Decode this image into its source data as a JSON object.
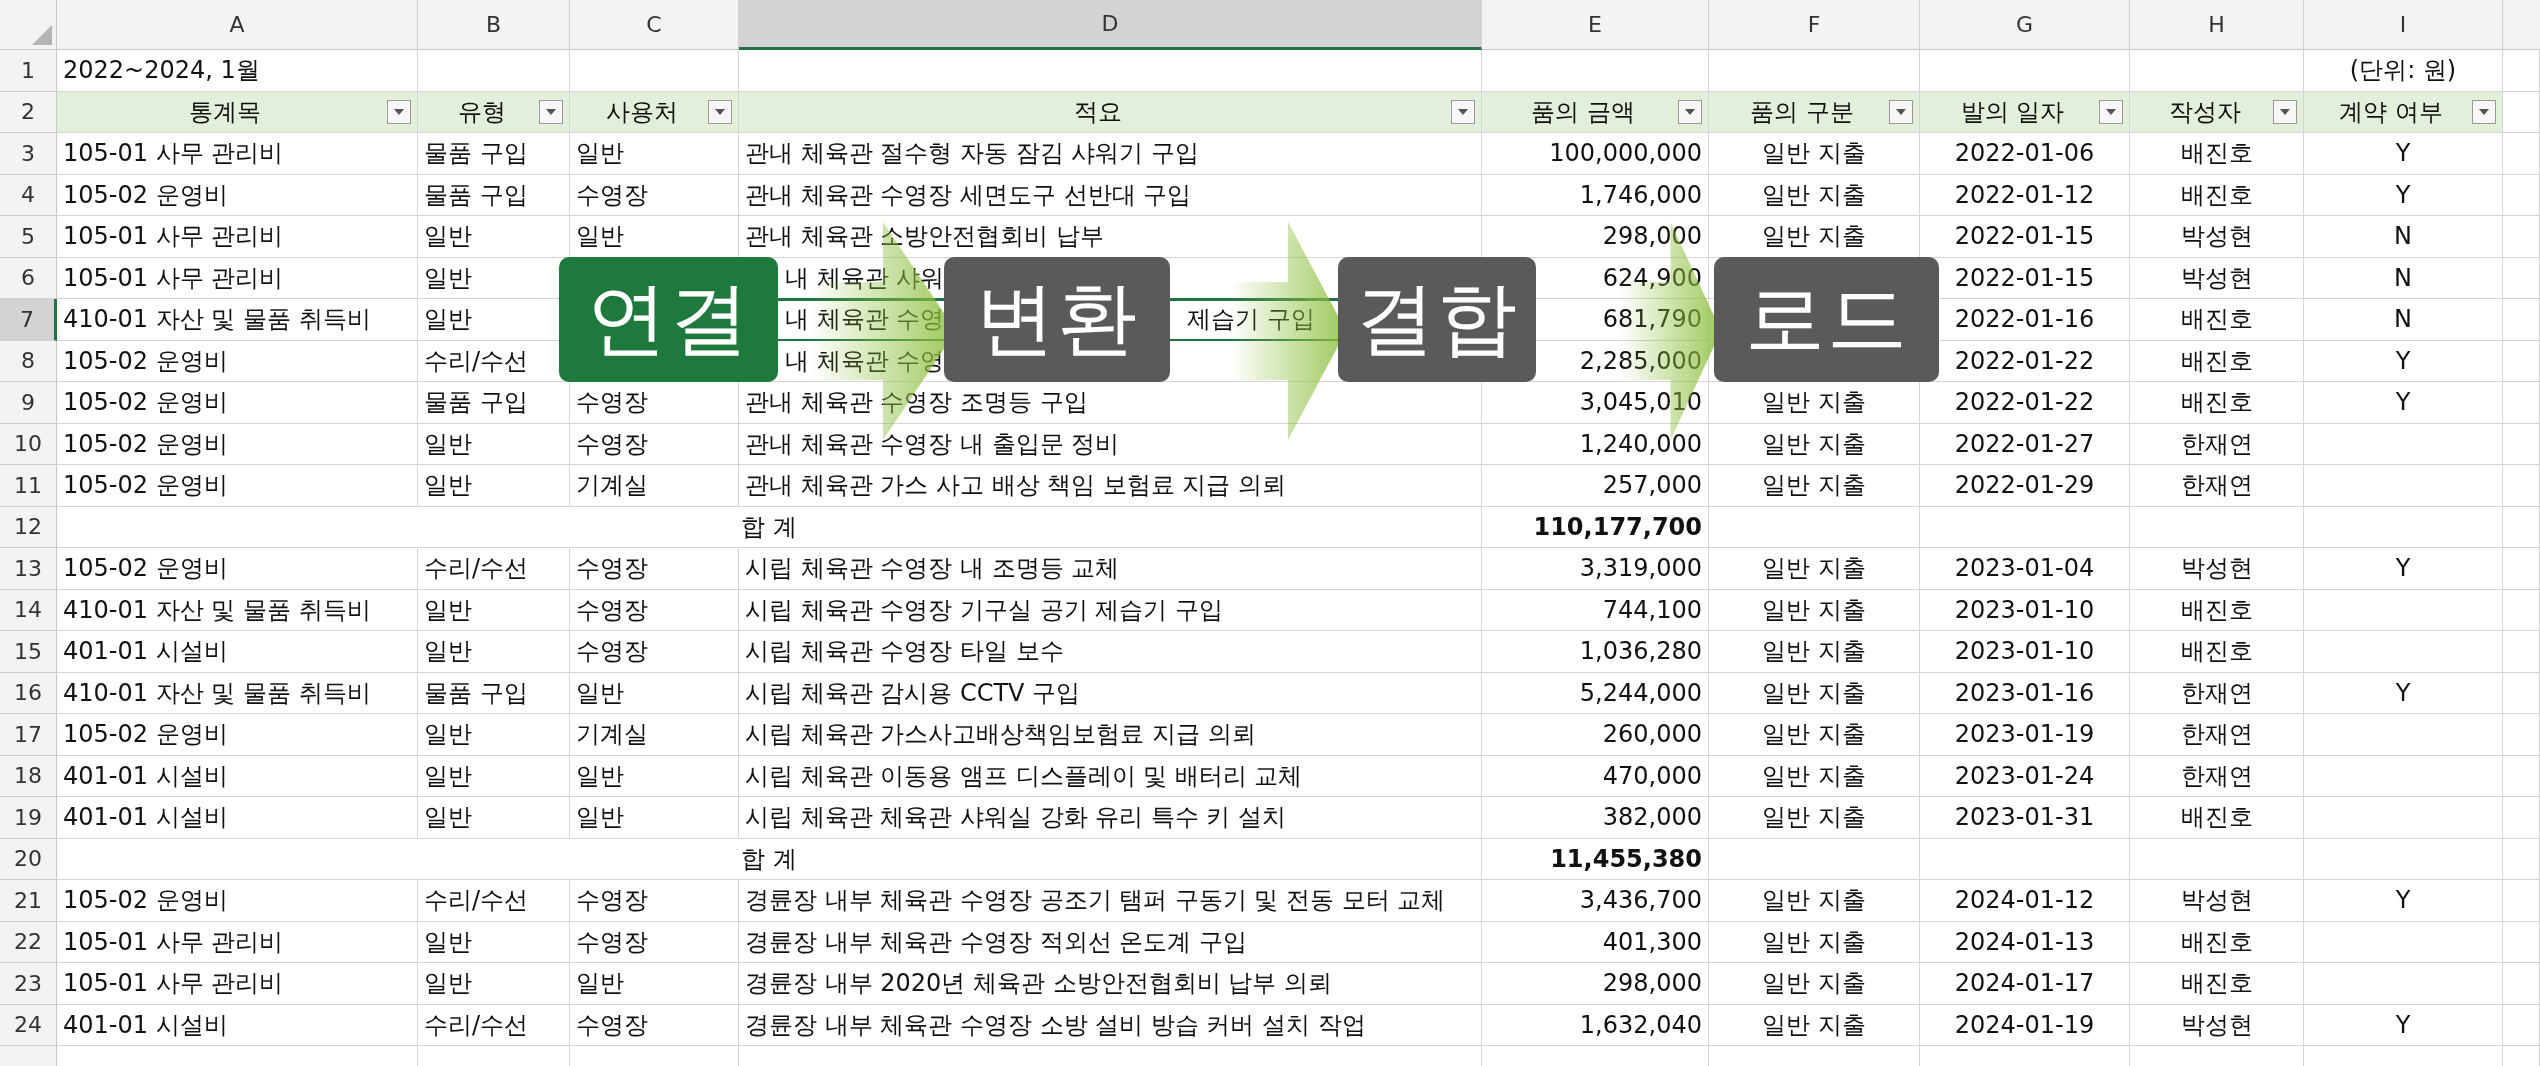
{
  "columns": [
    {
      "letter": "A",
      "selected": false
    },
    {
      "letter": "B",
      "selected": false
    },
    {
      "letter": "C",
      "selected": false
    },
    {
      "letter": "D",
      "selected": true
    },
    {
      "letter": "E",
      "selected": false
    },
    {
      "letter": "F",
      "selected": false
    },
    {
      "letter": "G",
      "selected": false
    },
    {
      "letter": "H",
      "selected": false
    },
    {
      "letter": "I",
      "selected": false
    }
  ],
  "rows": [
    {
      "number": "1",
      "selected": false,
      "kind": "title",
      "title": "2022~2024, 1월",
      "unit": "(단위: 원)"
    },
    {
      "number": "2",
      "selected": false,
      "kind": "header",
      "headers": [
        "통계목",
        "유형",
        "사용처",
        "적요",
        "품의 금액",
        "품의 구분",
        "발의 일자",
        "작성자",
        "계약 여부"
      ]
    },
    {
      "number": "3",
      "selected": false,
      "kind": "data",
      "account": "105-01 사무 관리비",
      "type": "물품 구입",
      "place": "일반",
      "summary": "관내 체육관 절수형 자동 잠김 샤워기 구입",
      "amount": "100,000,000",
      "category": "일반 지출",
      "date": "2022-01-06",
      "author": "배진호",
      "contract": "Y"
    },
    {
      "number": "4",
      "selected": false,
      "kind": "data",
      "account": "105-02 운영비",
      "type": "물품 구입",
      "place": "수영장",
      "summary": "관내 체육관 수영장 세면도구 선반대 구입",
      "amount": "1,746,000",
      "category": "일반 지출",
      "date": "2022-01-12",
      "author": "배진호",
      "contract": "Y"
    },
    {
      "number": "5",
      "selected": false,
      "kind": "data",
      "account": "105-01 사무 관리비",
      "type": "일반",
      "place": "일반",
      "summary": "관내 체육관 소방안전협회비 납부",
      "amount": "298,000",
      "category": "일반 지출",
      "date": "2022-01-15",
      "author": "박성현",
      "contract": "N"
    },
    {
      "number": "6",
      "selected": false,
      "kind": "covered",
      "account": "105-01 사무 관리비",
      "type": "일반",
      "summary": "내 체육관 샤워",
      "amount": "624,900",
      "date": "2022-01-15",
      "author": "박성현",
      "contract": "N"
    },
    {
      "number": "7",
      "selected": true,
      "kind": "covered",
      "account": "410-01 자산 및 물품 취득비",
      "type": "일반",
      "summary": "내 체육관 수영",
      "summary_tail": "제습기 구입",
      "amount": "681,790",
      "date": "2022-01-16",
      "author": "배진호",
      "contract": "N"
    },
    {
      "number": "8",
      "selected": false,
      "kind": "covered",
      "account": "105-02 운영비",
      "type": "수리/수선",
      "summary": "내 체육관 수영",
      "amount": "2,285,000",
      "date": "2022-01-22",
      "author": "배진호",
      "contract": "Y"
    },
    {
      "number": "9",
      "selected": false,
      "kind": "data",
      "account": "105-02 운영비",
      "type": "물품 구입",
      "place": "수영장",
      "summary": "관내 체육관 수영장 조명등 구입",
      "amount": "3,045,010",
      "category": "일반 지출",
      "date": "2022-01-22",
      "author": "배진호",
      "contract": "Y"
    },
    {
      "number": "10",
      "selected": false,
      "kind": "data",
      "account": "105-02 운영비",
      "type": "일반",
      "place": "수영장",
      "summary": "관내 체육관 수영장 내 출입문 정비",
      "amount": "1,240,000",
      "category": "일반 지출",
      "date": "2022-01-27",
      "author": "한재연"
    },
    {
      "number": "11",
      "selected": false,
      "kind": "data",
      "account": "105-02 운영비",
      "type": "일반",
      "place": "기계실",
      "summary": "관내 체육관 가스 사고 배상 책임 보험료 지급 의뢰",
      "amount": "257,000",
      "category": "일반 지출",
      "date": "2022-01-29",
      "author": "한재연"
    },
    {
      "number": "12",
      "selected": false,
      "kind": "total",
      "label": "합 계",
      "amount": "110,177,700"
    },
    {
      "number": "13",
      "selected": false,
      "kind": "data",
      "account": "105-02 운영비",
      "type": "수리/수선",
      "place": "수영장",
      "summary": "시립 체육관 수영장 내 조명등 교체",
      "amount": "3,319,000",
      "category": "일반 지출",
      "date": "2023-01-04",
      "author": "박성현",
      "contract": "Y"
    },
    {
      "number": "14",
      "selected": false,
      "kind": "data",
      "account": "410-01 자산 및 물품 취득비",
      "type": "일반",
      "place": "수영장",
      "summary": "시립 체육관 수영장 기구실 공기 제습기 구입",
      "amount": "744,100",
      "category": "일반 지출",
      "date": "2023-01-10",
      "author": "배진호"
    },
    {
      "number": "15",
      "selected": false,
      "kind": "data",
      "account": "401-01 시설비",
      "type": "일반",
      "place": "수영장",
      "summary": "시립 체육관 수영장 타일 보수",
      "amount": "1,036,280",
      "category": "일반 지출",
      "date": "2023-01-10",
      "author": "배진호"
    },
    {
      "number": "16",
      "selected": false,
      "kind": "data",
      "account": "410-01 자산 및 물품 취득비",
      "type": "물품 구입",
      "place": "일반",
      "summary": "시립 체육관 감시용 CCTV 구입",
      "amount": "5,244,000",
      "category": "일반 지출",
      "date": "2023-01-16",
      "author": "한재연",
      "contract": "Y"
    },
    {
      "number": "17",
      "selected": false,
      "kind": "data",
      "account": "105-02 운영비",
      "type": "일반",
      "place": "기계실",
      "summary": "시립 체육관 가스사고배상책임보험료 지급 의뢰",
      "amount": "260,000",
      "category": "일반 지출",
      "date": "2023-01-19",
      "author": "한재연"
    },
    {
      "number": "18",
      "selected": false,
      "kind": "data",
      "account": "401-01 시설비",
      "type": "일반",
      "place": "일반",
      "summary": "시립 체육관 이동용 앰프 디스플레이 및 배터리 교체",
      "amount": "470,000",
      "category": "일반 지출",
      "date": "2023-01-24",
      "author": "한재연"
    },
    {
      "number": "19",
      "selected": false,
      "kind": "data",
      "account": "401-01 시설비",
      "type": "일반",
      "place": "일반",
      "summary": "시립 체육관 체육관 샤워실 강화 유리 특수 키 설치",
      "amount": "382,000",
      "category": "일반 지출",
      "date": "2023-01-31",
      "author": "배진호"
    },
    {
      "number": "20",
      "selected": false,
      "kind": "total",
      "label": "합 계",
      "amount": "11,455,380"
    },
    {
      "number": "21",
      "selected": false,
      "kind": "data",
      "account": "105-02 운영비",
      "type": "수리/수선",
      "place": "수영장",
      "summary": "경륜장 내부 체육관 수영장 공조기 탬퍼 구동기 및 전동 모터 교체",
      "amount": "3,436,700",
      "category": "일반 지출",
      "date": "2024-01-12",
      "author": "박성현",
      "contract": "Y"
    },
    {
      "number": "22",
      "selected": false,
      "kind": "data",
      "account": "105-01 사무 관리비",
      "type": "일반",
      "place": "수영장",
      "summary": "경륜장 내부 체육관 수영장 적외선 온도계 구입",
      "amount": "401,300",
      "category": "일반 지출",
      "date": "2024-01-13",
      "author": "배진호"
    },
    {
      "number": "23",
      "selected": false,
      "kind": "data",
      "account": "105-01 사무 관리비",
      "type": "일반",
      "place": "일반",
      "summary": "경륜장 내부 2020년 체육관 소방안전협회비 납부 의뢰",
      "amount": "298,000",
      "category": "일반 지출",
      "date": "2024-01-17",
      "author": "배진호"
    },
    {
      "number": "24",
      "selected": false,
      "kind": "data",
      "account": "401-01 시설비",
      "type": "수리/수선",
      "place": "수영장",
      "summary": "경륜장 내부 체육관 수영장 소방 설비 방습 커버 설치 작업",
      "amount": "1,632,040",
      "category": "일반 지출",
      "date": "2024-01-19",
      "author": "박성현",
      "contract": "Y"
    }
  ],
  "pipeline": [
    {
      "label": "연결",
      "color": "#1d7a3c"
    },
    {
      "label": "변환",
      "color": "#5a5a5a"
    },
    {
      "label": "결합",
      "color": "#5a5a5a"
    },
    {
      "label": "로드",
      "color": "#5a5a5a"
    }
  ]
}
